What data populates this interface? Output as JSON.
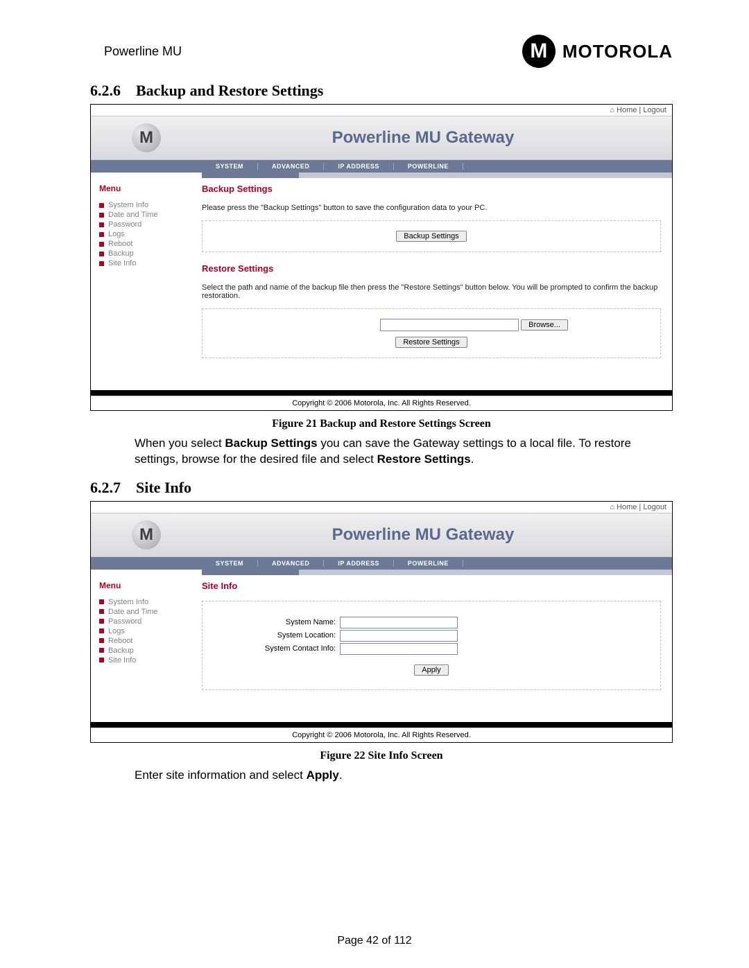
{
  "doc": {
    "header_title": "Powerline MU",
    "brand_word": "MOTOROLA",
    "page_num": "Page 42 of 112"
  },
  "sec1": {
    "num": "6.2.6",
    "title": "Backup and Restore Settings",
    "figure_caption": "Figure 21 Backup and Restore Settings Screen",
    "body_pre": "When you select ",
    "body_bold1": "Backup Settings",
    "body_mid": " you can save the Gateway settings to a local file. To restore settings, browse for the desired file and select ",
    "body_bold2": "Restore Settings",
    "body_post": "."
  },
  "sec2": {
    "num": "6.2.7",
    "title": "Site Info",
    "figure_caption": "Figure 22 Site Info Screen",
    "body_pre": "Enter site information and select ",
    "body_bold": "Apply",
    "body_post": "."
  },
  "shot_common": {
    "home": "Home",
    "logout": "Logout",
    "banner_title": "Powerline MU Gateway",
    "nav": [
      "SYSTEM",
      "ADVANCED",
      "IP ADDRESS",
      "POWERLINE"
    ],
    "menu_title": "Menu",
    "menu_items": [
      "System Info",
      "Date and Time",
      "Password",
      "Logs",
      "Reboot",
      "Backup",
      "Site Info"
    ],
    "copyright": "Copyright  ©    2006  Motorola, Inc.  All Rights Reserved."
  },
  "shot1": {
    "title1": "Backup Settings",
    "desc1": "Please press the \"Backup Settings\" button to save the configuration data to your PC.",
    "btn_backup": "Backup Settings",
    "title2": "Restore Settings",
    "desc2": "Select the path and name of the backup file then press the \"Restore Settings\" button below. You will be prompted to confirm the backup restoration.",
    "btn_browse": "Browse...",
    "btn_restore": "Restore Settings"
  },
  "shot2": {
    "title": "Site Info",
    "labels": {
      "name": "System Name:",
      "location": "System Location:",
      "contact": "System Contact Info:"
    },
    "btn_apply": "Apply"
  }
}
